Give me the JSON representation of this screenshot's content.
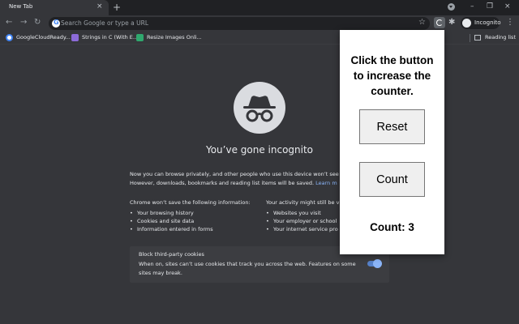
{
  "browser": {
    "tab": {
      "title": "New Tab",
      "close_glyph": "×"
    },
    "new_tab_glyph": "+",
    "omnibox": {
      "placeholder": "Search Google or type a URL"
    },
    "profile_label": "Incognito",
    "window_controls": [
      "–",
      "❐",
      "×"
    ],
    "nav_glyphs": {
      "back": "←",
      "forward": "→",
      "reload": "↻"
    }
  },
  "bookmarks": [
    {
      "label": "GoogleCloudReady...",
      "icon": "google-icon",
      "color": "#4285f4"
    },
    {
      "label": "Strings in C (With E...",
      "icon": "programiz-icon",
      "color": "#8c6bd8"
    },
    {
      "label": "Resize Images Onli...",
      "icon": "resize-icon",
      "color": "#2fa86e"
    }
  ],
  "reading_list": "Reading list",
  "incognito_page": {
    "headline": "You’ve gone incognito",
    "intro_line1": "Now you can browse privately, and other people who use this device won’t see",
    "intro_line2_text": "However, downloads, bookmarks and reading list items will be saved.",
    "intro_link": "Learn m",
    "left_col": {
      "heading": "Chrome won’t save the following information:",
      "items": [
        "Your browsing history",
        "Cookies and site data",
        "Information entered in forms"
      ]
    },
    "right_col": {
      "heading": "Your activity might still be v",
      "items": [
        "Websites you visit",
        "Your employer or school",
        "Your internet service pro"
      ]
    },
    "cookies": {
      "title": "Block third-party cookies",
      "description": "When on, sites can’t use cookies that track you across the web. Features on some sites may break.",
      "enabled": true
    }
  },
  "popup": {
    "title": "Click the button to increase the counter.",
    "reset_label": "Reset",
    "count_label": "Count",
    "counter_text": "Count: 3"
  },
  "colors": {
    "tabstrip": "#202124",
    "toolbar": "#35363a",
    "accent": "#8ab4f8",
    "popup_bg": "#ffffff"
  }
}
